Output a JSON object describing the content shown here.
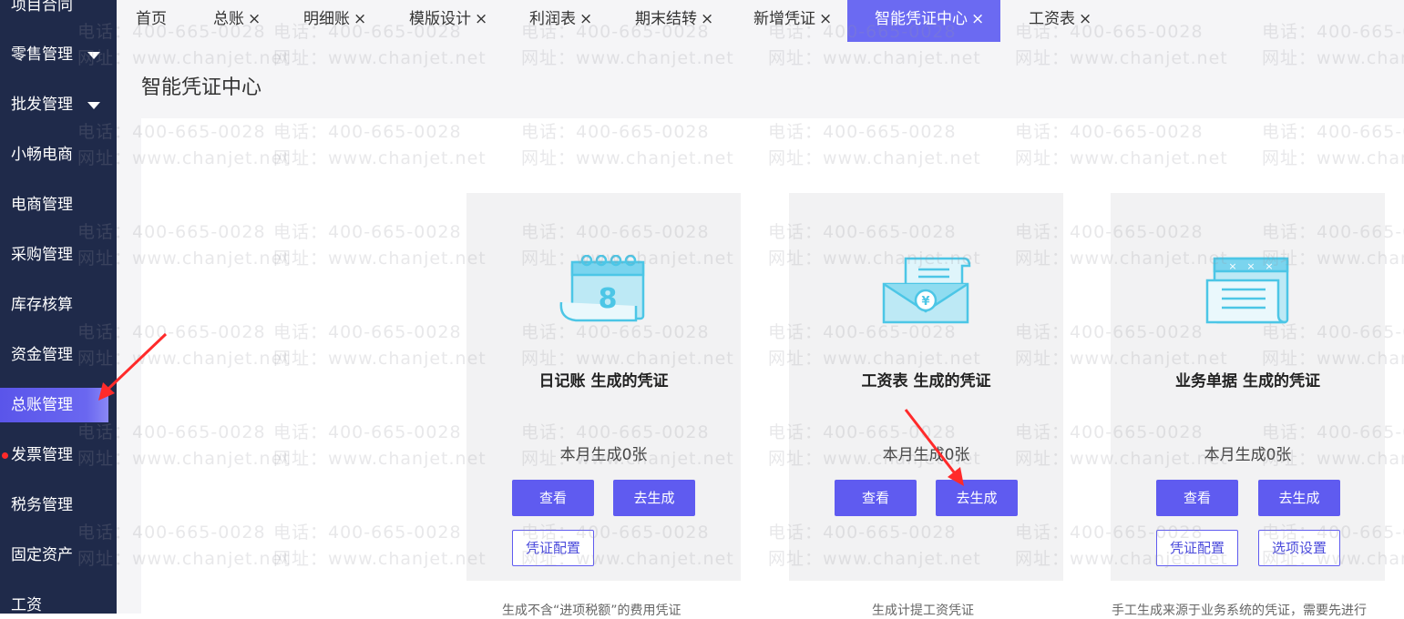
{
  "sidebar": {
    "items": [
      {
        "label": "项目合同",
        "has_arrow": false
      },
      {
        "label": "零售管理",
        "has_arrow": true
      },
      {
        "label": "批发管理",
        "has_arrow": true
      },
      {
        "label": "小畅电商",
        "has_arrow": false
      },
      {
        "label": "电商管理",
        "has_arrow": false
      },
      {
        "label": "采购管理",
        "has_arrow": false
      },
      {
        "label": "库存核算",
        "has_arrow": false
      },
      {
        "label": "资金管理",
        "has_arrow": false
      },
      {
        "label": "总账管理",
        "has_arrow": false,
        "active": true
      },
      {
        "label": "发票管理",
        "has_arrow": false,
        "red_dot": true
      },
      {
        "label": "税务管理",
        "has_arrow": false
      },
      {
        "label": "固定资产",
        "has_arrow": false
      },
      {
        "label": "工资",
        "has_arrow": false
      }
    ]
  },
  "tabs": [
    {
      "label": "首页",
      "closable": false
    },
    {
      "label": "总账",
      "closable": true
    },
    {
      "label": "明细账",
      "closable": true
    },
    {
      "label": "模版设计",
      "closable": true
    },
    {
      "label": "利润表",
      "closable": true
    },
    {
      "label": "期末结转",
      "closable": true
    },
    {
      "label": "新增凭证",
      "closable": true
    },
    {
      "label": "智能凭证中心",
      "closable": true,
      "active": true
    },
    {
      "label": "工资表",
      "closable": true
    }
  ],
  "close_glyph": "×",
  "page_title": "智能凭证中心",
  "cards": [
    {
      "icon": "calendar-icon",
      "title": "日记账 生成的凭证",
      "count_text": "本月生成0张",
      "view_label": "查看",
      "generate_label": "去生成",
      "config_label": "凭证配置",
      "options_label": null,
      "description": "生成不含“进项税额”的费用凭证"
    },
    {
      "icon": "salary-envelope-icon",
      "title": "工资表 生成的凭证",
      "count_text": "本月生成0张",
      "view_label": "查看",
      "generate_label": "去生成",
      "config_label": null,
      "options_label": null,
      "description": "生成计提工资凭证"
    },
    {
      "icon": "document-list-icon",
      "title": "业务单据 生成的凭证",
      "count_text": "本月生成0张",
      "view_label": "查看",
      "generate_label": "去生成",
      "config_label": "凭证配置",
      "options_label": "选项设置",
      "description": "手工生成来源于业务系统的凭证，需要先进行"
    }
  ],
  "watermark": {
    "phone": "电话：400-665-0028",
    "site": "网址：www.chanjet.net"
  },
  "colors": {
    "sidebar_bg": "#1f2a4a",
    "accent": "#5f5bf0",
    "active_tab": "#6b6af2",
    "card_bg": "#f2f2f3",
    "icon_cyan": "#4cc6e6",
    "annotation_red": "#ff2a2a"
  }
}
